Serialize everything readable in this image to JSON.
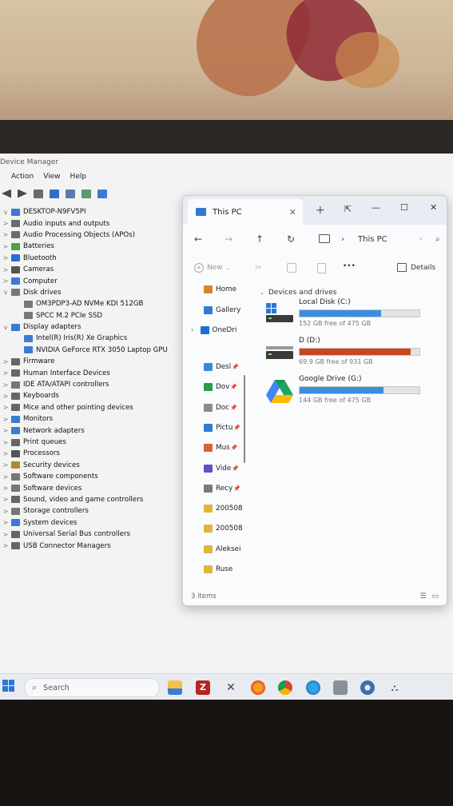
{
  "device_manager": {
    "title": "Device Manager",
    "menu": [
      "Action",
      "View",
      "Help"
    ],
    "tree": [
      {
        "label": "DESKTOP-N9FV5PI",
        "level": 0,
        "chevron": "v",
        "icon_color": "#3b7bd3"
      },
      {
        "label": "Audio inputs and outputs",
        "level": 1,
        "chevron": ">",
        "icon_color": "#6b6b6b"
      },
      {
        "label": "Audio Processing Objects (APOs)",
        "level": 1,
        "chevron": ">",
        "icon_color": "#6b6b6b"
      },
      {
        "label": "Batteries",
        "level": 1,
        "chevron": ">",
        "icon_color": "#4aa24a"
      },
      {
        "label": "Bluetooth",
        "level": 1,
        "chevron": ">",
        "icon_color": "#2a6fd0"
      },
      {
        "label": "Cameras",
        "level": 1,
        "chevron": ">",
        "icon_color": "#555555"
      },
      {
        "label": "Computer",
        "level": 1,
        "chevron": ">",
        "icon_color": "#3b7bd3"
      },
      {
        "label": "Disk drives",
        "level": 1,
        "chevron": "v",
        "icon_color": "#777777"
      },
      {
        "label": "OM3PDP3-AD NVMe KDI 512GB",
        "level": 2,
        "chevron": "",
        "icon_color": "#777777"
      },
      {
        "label": "SPCC M.2 PCIe SSD",
        "level": 2,
        "chevron": "",
        "icon_color": "#777777"
      },
      {
        "label": "Display adapters",
        "level": 1,
        "chevron": "v",
        "icon_color": "#3b7bd3"
      },
      {
        "label": "Intel(R) Iris(R) Xe Graphics",
        "level": 2,
        "chevron": "",
        "icon_color": "#3b7bd3"
      },
      {
        "label": "NVIDIA GeForce RTX 3050 Laptop GPU",
        "level": 2,
        "chevron": "",
        "icon_color": "#3b7bd3"
      },
      {
        "label": "Firmware",
        "level": 1,
        "chevron": ">",
        "icon_color": "#666666"
      },
      {
        "label": "Human Interface Devices",
        "level": 1,
        "chevron": ">",
        "icon_color": "#666666"
      },
      {
        "label": "IDE ATA/ATAPI controllers",
        "level": 1,
        "chevron": ">",
        "icon_color": "#777777"
      },
      {
        "label": "Keyboards",
        "level": 1,
        "chevron": ">",
        "icon_color": "#666666"
      },
      {
        "label": "Mice and other pointing devices",
        "level": 1,
        "chevron": ">",
        "icon_color": "#666666"
      },
      {
        "label": "Monitors",
        "level": 1,
        "chevron": ">",
        "icon_color": "#3b7bd3"
      },
      {
        "label": "Network adapters",
        "level": 1,
        "chevron": ">",
        "icon_color": "#3b7bd3"
      },
      {
        "label": "Print queues",
        "level": 1,
        "chevron": ">",
        "icon_color": "#666666"
      },
      {
        "label": "Processors",
        "level": 1,
        "chevron": ">",
        "icon_color": "#555555"
      },
      {
        "label": "Security devices",
        "level": 1,
        "chevron": ">",
        "icon_color": "#b08a2e"
      },
      {
        "label": "Software components",
        "level": 1,
        "chevron": ">",
        "icon_color": "#777777"
      },
      {
        "label": "Software devices",
        "level": 1,
        "chevron": ">",
        "icon_color": "#777777"
      },
      {
        "label": "Sound, video and game controllers",
        "level": 1,
        "chevron": ">",
        "icon_color": "#666666"
      },
      {
        "label": "Storage controllers",
        "level": 1,
        "chevron": ">",
        "icon_color": "#777777"
      },
      {
        "label": "System devices",
        "level": 1,
        "chevron": ">",
        "icon_color": "#3b7bd3"
      },
      {
        "label": "Universal Serial Bus controllers",
        "level": 1,
        "chevron": ">",
        "icon_color": "#666666"
      },
      {
        "label": "USB Connector Managers",
        "level": 1,
        "chevron": ">",
        "icon_color": "#666666"
      }
    ]
  },
  "explorer": {
    "tab_title": "This PC",
    "address": "This PC",
    "new_label": "New",
    "details_label": "Details",
    "more_label": "•••",
    "group_label": "Devices and drives",
    "status": "3 items",
    "sidebar": [
      {
        "label": "Home",
        "icon_color": "#d9862b",
        "pinned": false,
        "chevron": false
      },
      {
        "label": "Gallery",
        "icon_color": "#2f7bd2",
        "pinned": false,
        "chevron": false
      },
      {
        "label": "OneDri",
        "icon_color": "#1f6fd1",
        "pinned": false,
        "chevron": true
      },
      {
        "label": "Desl",
        "icon_color": "#3b87d8",
        "pinned": true,
        "chevron": false
      },
      {
        "label": "Dov",
        "icon_color": "#2a9b4a",
        "pinned": true,
        "chevron": false
      },
      {
        "label": "Doc",
        "icon_color": "#8a8a8a",
        "pinned": true,
        "chevron": false
      },
      {
        "label": "Pictu",
        "icon_color": "#2f7bd2",
        "pinned": true,
        "chevron": false
      },
      {
        "label": "Mus",
        "icon_color": "#d9603b",
        "pinned": true,
        "chevron": false
      },
      {
        "label": "Vide",
        "icon_color": "#6a4bc8",
        "pinned": true,
        "chevron": false
      },
      {
        "label": "Recy",
        "icon_color": "#7a7a7a",
        "pinned": true,
        "chevron": false
      },
      {
        "label": "200508",
        "icon_color": "#e0b53c",
        "pinned": false,
        "chevron": false
      },
      {
        "label": "200508",
        "icon_color": "#e0b53c",
        "pinned": false,
        "chevron": false
      },
      {
        "label": "Aleksei",
        "icon_color": "#e0b53c",
        "pinned": false,
        "chevron": false
      },
      {
        "label": "Ruse",
        "icon_color": "#e0b53c",
        "pinned": false,
        "chevron": false
      }
    ],
    "drives": [
      {
        "name": "Local Disk (C:)",
        "free_text": "152 GB free of 475 GB",
        "used_fraction": 0.68,
        "bar_color": "#3b8de0",
        "icon": "windows-drive-icon"
      },
      {
        "name": "D (D:)",
        "free_text": "69.9 GB free of 931 GB",
        "used_fraction": 0.925,
        "bar_color": "#c8461f",
        "icon": "drive-icon"
      },
      {
        "name": "Google Drive (G:)",
        "free_text": "144 GB free of 475 GB",
        "used_fraction": 0.7,
        "bar_color": "#3b8de0",
        "icon": "google-drive-icon"
      }
    ]
  },
  "taskbar": {
    "search_label": "Search"
  }
}
